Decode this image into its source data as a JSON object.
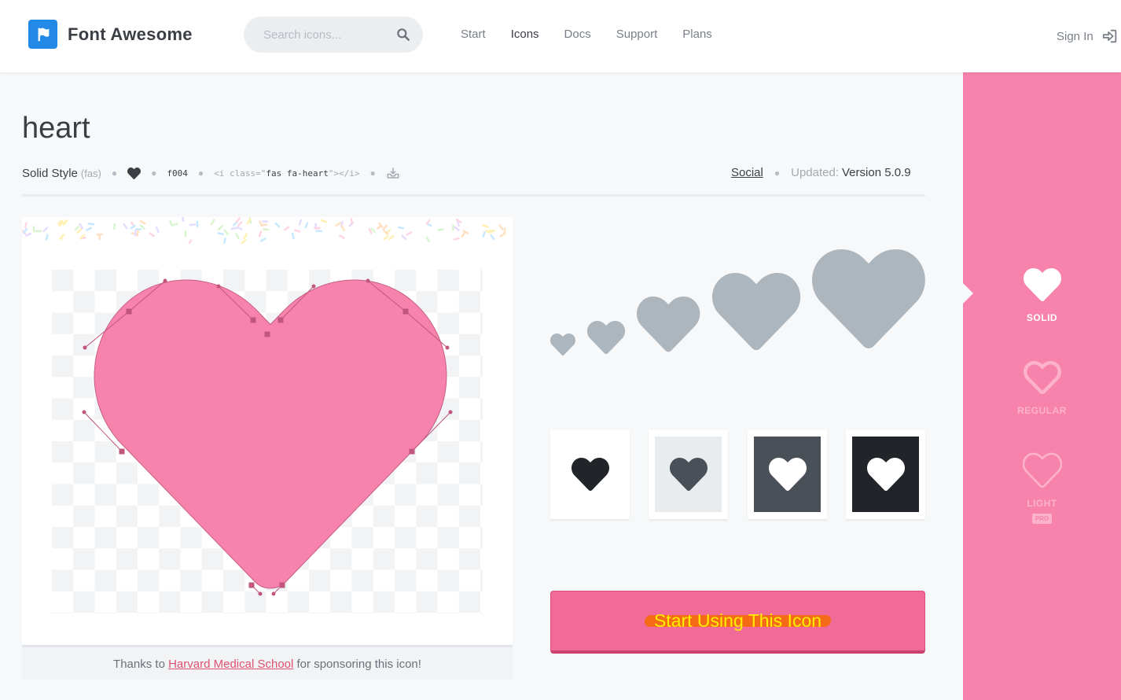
{
  "header": {
    "brand": "Font Awesome",
    "logo_icon": "flag-icon",
    "search": {
      "placeholder": "Search icons...",
      "icon": "search-icon"
    },
    "nav": [
      {
        "label": "Start",
        "active": false
      },
      {
        "label": "Icons",
        "active": true
      },
      {
        "label": "Docs",
        "active": false
      },
      {
        "label": "Support",
        "active": false
      },
      {
        "label": "Plans",
        "active": false
      }
    ],
    "signin": {
      "label": "Sign In",
      "icon": "sign-in-icon"
    }
  },
  "icon": {
    "name": "heart",
    "style_label": "Solid Style",
    "style_prefix": "(fas)",
    "unicode": "f004",
    "snippet_pre": "<i class=\"",
    "snippet_class": "fas fa-heart",
    "snippet_post": "\"></i>",
    "category": "Social",
    "updated_label": "Updated:",
    "version": "Version 5.0.9"
  },
  "preview": {
    "sponsor_pre": "Thanks to",
    "sponsor_name": "Harvard Medical School",
    "sponsor_post": "for sponsoring this icon!",
    "heart_color": "#f783ac"
  },
  "swatches": [
    {
      "background": "#ffffff",
      "icon_color": "#212529"
    },
    {
      "background": "#e9ecef",
      "icon_color": "#495057"
    },
    {
      "background": "#495057",
      "icon_color": "#ffffff"
    },
    {
      "background": "#212529",
      "icon_color": "#ffffff"
    }
  ],
  "cta": {
    "label": "Start Using This Icon"
  },
  "styles": [
    {
      "label": "SOLID",
      "active": true,
      "icon": "heart-solid-icon"
    },
    {
      "label": "REGULAR",
      "active": false,
      "icon": "heart-regular-icon"
    },
    {
      "label": "LIGHT",
      "active": false,
      "icon": "heart-light-icon",
      "badge": "PRO"
    }
  ],
  "colors": {
    "brand_blue": "#228ae6",
    "pink": "#f783ac",
    "cta": "#f06b97",
    "gray_heart": "#adb5bd"
  }
}
